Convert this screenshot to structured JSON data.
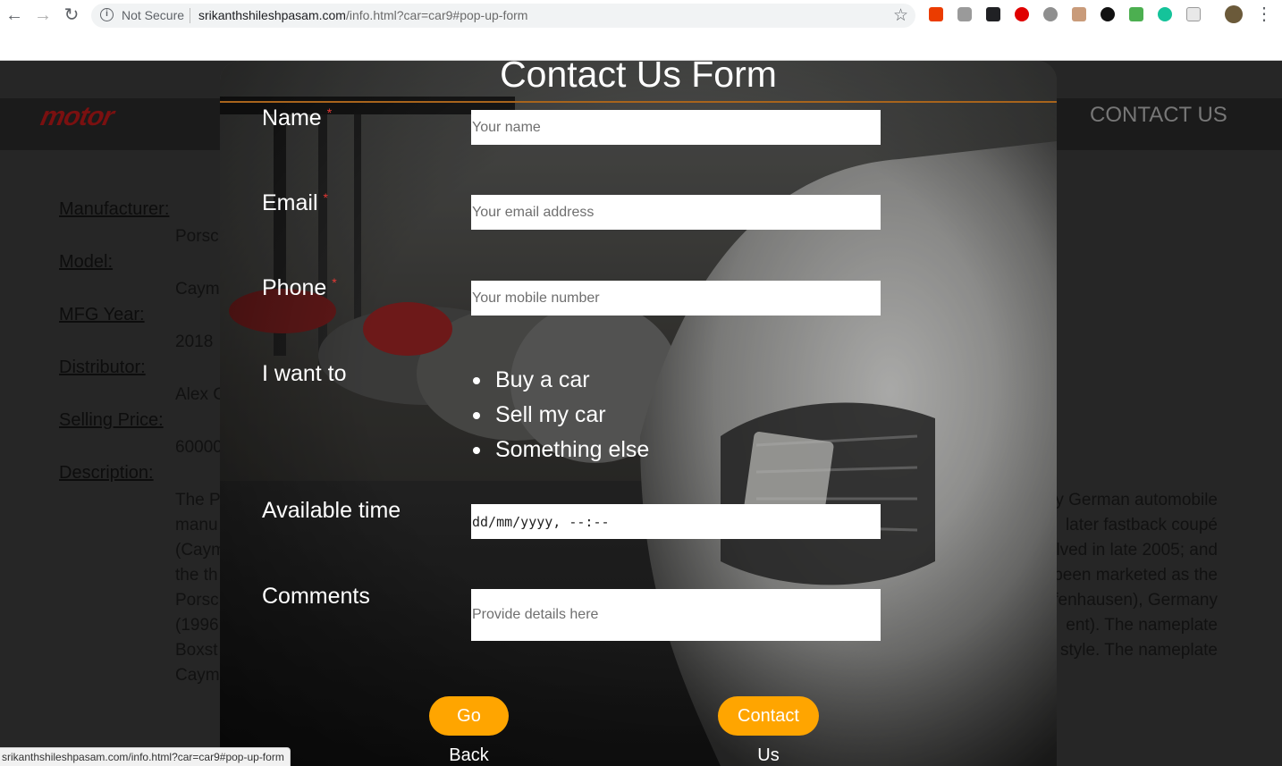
{
  "browser": {
    "security_label": "Not Secure",
    "url_host": "srikanthshileshpasam.com",
    "url_path": "/info.html?car=car9#pop-up-form",
    "status_url": "srikanthshileshpasam.com/info.html?car=car9#pop-up-form"
  },
  "page": {
    "nav_contact": "CONTACT US",
    "details": [
      {
        "label": "Manufacturer:",
        "value": "Porsc"
      },
      {
        "label": "Model:",
        "value": "Caym"
      },
      {
        "label": "MFG Year:",
        "value": "2018"
      },
      {
        "label": "Distributor:",
        "value": "Alex C"
      },
      {
        "label": "Selling Price:",
        "value": "60000"
      },
      {
        "label": "Description:",
        "value": ""
      }
    ],
    "description_left": [
      "The P",
      "manu",
      "(Caym",
      "the th",
      "Porsc",
      "(1996",
      "Boxst",
      "Caym"
    ],
    "description_right": [
      "y German automobile",
      "later fastback coupé",
      "lved in late 2005; and",
      "been marketed as the",
      "fenhausen), Germany",
      "ent). The nameplate",
      "style. The nameplate"
    ]
  },
  "modal": {
    "title": "Contact Us Form",
    "required_mark": "*",
    "name_label": "Name",
    "name_placeholder": "Your name",
    "email_label": "Email",
    "email_placeholder": "Your email address",
    "phone_label": "Phone",
    "phone_placeholder": "Your mobile number",
    "intent_label": "I want to",
    "intent_options": [
      "Buy a car",
      "Sell my car",
      "Something else"
    ],
    "time_label": "Available time",
    "time_placeholder": "dd/mm/yyyy, --:--",
    "comments_label": "Comments",
    "comments_placeholder": "Provide details here",
    "back_button": "Go Back",
    "submit_button": "Contact Us"
  },
  "colors": {
    "accent_button": "#ffa500",
    "title_rule": "#a8641c",
    "required": "#e53935"
  }
}
